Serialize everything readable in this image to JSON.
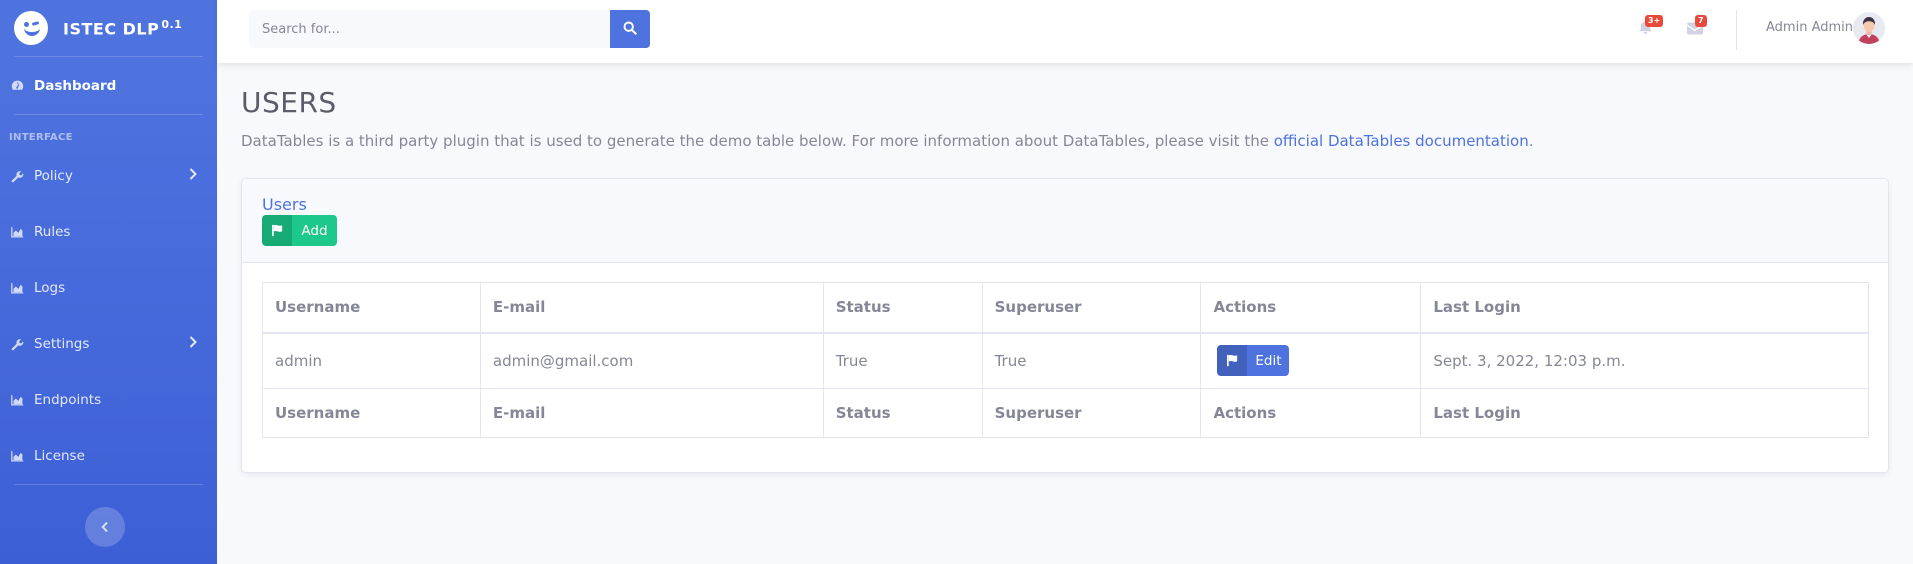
{
  "brand": {
    "name": "ISTEC DLP",
    "version": "0.1"
  },
  "sidebar": {
    "dashboard": "Dashboard",
    "heading": "INTERFACE",
    "items": [
      {
        "label": "Policy",
        "icon": "wrench-icon",
        "has_submenu": true
      },
      {
        "label": "Rules",
        "icon": "chart-area-icon",
        "has_submenu": false
      },
      {
        "label": "Logs",
        "icon": "chart-area-icon",
        "has_submenu": false
      },
      {
        "label": "Settings",
        "icon": "wrench-icon",
        "has_submenu": true
      },
      {
        "label": "Endpoints",
        "icon": "chart-area-icon",
        "has_submenu": false
      },
      {
        "label": "License",
        "icon": "chart-area-icon",
        "has_submenu": false
      }
    ]
  },
  "topbar": {
    "search_placeholder": "Search for...",
    "alerts_count": "3+",
    "messages_count": "7",
    "user_name": "Admin Admin"
  },
  "page": {
    "title": "USERS",
    "description": "DataTables is a third party plugin that is used to generate the demo table below. For more information about DataTables, please visit the ",
    "link_text": "official DataTables documentation",
    "description_end": "."
  },
  "card": {
    "title": "Users",
    "add_label": "Add"
  },
  "table": {
    "columns": [
      "Username",
      "E-mail",
      "Status",
      "Superuser",
      "Actions",
      "Last Login"
    ],
    "rows": [
      {
        "username": "admin",
        "email": "admin@gmail.com",
        "status": "True",
        "superuser": "True",
        "action_label": "Edit",
        "last_login": "Sept. 3, 2022, 12:03 p.m."
      }
    ]
  },
  "colors": {
    "primary": "#4e73df",
    "success": "#1cc88a",
    "danger": "#e74a3b"
  }
}
